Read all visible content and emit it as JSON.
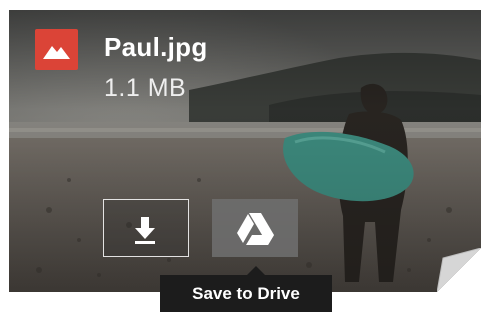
{
  "file": {
    "name": "Paul.jpg",
    "size": "1.1 MB",
    "type_icon": "image-file-icon",
    "type_color": "#db4437"
  },
  "actions": {
    "download_icon": "download-arrow-icon",
    "drive_icon": "google-drive-icon",
    "drive_tooltip": "Save to Drive"
  }
}
